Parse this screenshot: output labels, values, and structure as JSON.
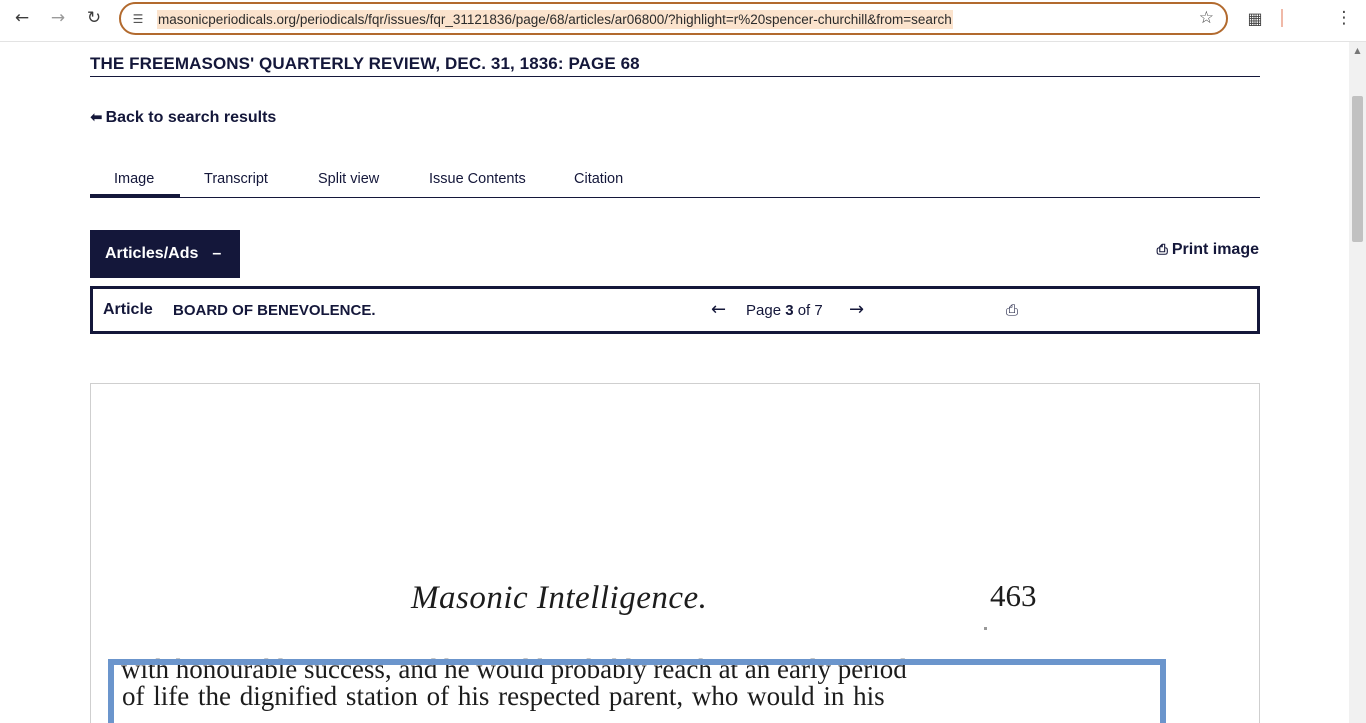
{
  "browser": {
    "url": "masonicperiodicals.org/periodicals/fqr/issues/fqr_31121836/page/68/articles/ar06800/?highlight=r%20spencer-churchill&from=search",
    "icons": {
      "back": "arrow-left-icon",
      "forward": "arrow-right-icon",
      "reload": "reload-icon",
      "site_info": "tune-icon",
      "bookmark": "star-icon",
      "extensions": "puzzle-icon",
      "menu": "kebab-menu-icon"
    }
  },
  "page": {
    "title": "THE FREEMASONS' QUARTERLY REVIEW, DEC. 31, 1836: PAGE 68",
    "back_label": "Back to search results"
  },
  "tabs": [
    {
      "label": "Image",
      "active": true
    },
    {
      "label": "Transcript",
      "active": false
    },
    {
      "label": "Split view",
      "active": false
    },
    {
      "label": "Issue Contents",
      "active": false
    },
    {
      "label": "Citation",
      "active": false
    }
  ],
  "toolbar": {
    "articles_label": "Articles/Ads",
    "articles_toggle": "–",
    "print_image_label": "Print image"
  },
  "article_bar": {
    "label": "Article",
    "name": "BOARD OF BENEVOLENCE.",
    "prev": "←",
    "next": "→",
    "page_prefix": "Page ",
    "page_current": "3",
    "page_suffix": " of 7"
  },
  "scan": {
    "heading": "Masonic Intelligence.",
    "page_number": "463",
    "line1": "with honourable success, and he would probably reach at an early period",
    "line2": "of life the dignified station of his respected parent, who would in his",
    "line3": "…  …  …  …  …  …  …  …  …  …  …  …  …  …"
  },
  "colors": {
    "navy": "#14173a",
    "highlight": "#6b95cc",
    "omnibox_border": "#b26a2e",
    "url_highlight": "#fbe3cd"
  }
}
